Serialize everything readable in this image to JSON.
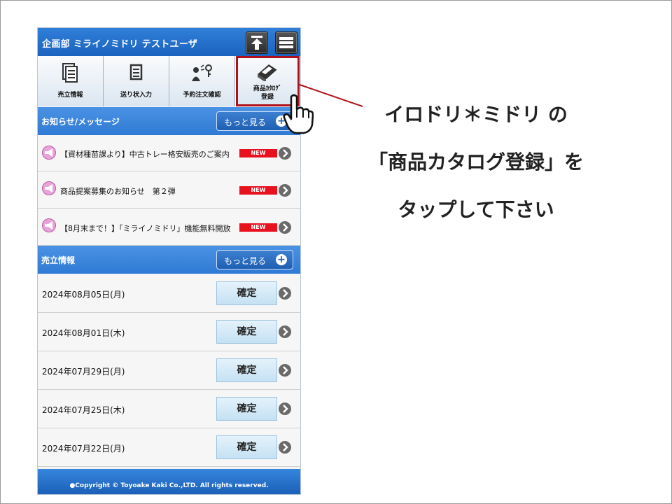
{
  "header": {
    "title": "企画部 ミライノミドリ テストユーザ"
  },
  "tabs": [
    {
      "label": "売立情報",
      "icon": "documents-icon"
    },
    {
      "label": "送り状入力",
      "icon": "document-icon"
    },
    {
      "label": "予約注文確認",
      "icon": "person-key-icon"
    },
    {
      "label": "商品ｶﾀﾛｸﾞ",
      "label2": "登録",
      "icon": "catalog-book-icon"
    }
  ],
  "notices": {
    "title": "お知らせ/メッセージ",
    "more_label": "もっと見る",
    "items": [
      {
        "text": "【資材種苗課より】中古トレー格安販売のご案内",
        "badge": "NEW"
      },
      {
        "text": "商品提案募集のお知らせ　第２弾",
        "badge": "NEW"
      },
      {
        "text": "【8月末まで！】「ミライノミドリ」機能無料開放",
        "badge": "NEW"
      }
    ]
  },
  "sales": {
    "title": "売立情報",
    "more_label": "もっと見る",
    "items": [
      {
        "date": "2024年08月05日(月)",
        "action": "確定"
      },
      {
        "date": "2024年08月01日(木)",
        "action": "確定"
      },
      {
        "date": "2024年07月29日(月)",
        "action": "確定"
      },
      {
        "date": "2024年07月25日(木)",
        "action": "確定"
      },
      {
        "date": "2024年07月22日(月)",
        "action": "確定"
      }
    ]
  },
  "footer": {
    "copyright": "●Copyright © Toyoake Kaki Co.,LTD. All rights reserved."
  },
  "callout": {
    "line1": "イロドリ＊ミドリ の",
    "line2": "「商品カタログ登録」を",
    "line3": "タップして下さい"
  },
  "colors": {
    "header_blue": "#1b63bf",
    "highlight_red": "#b0121b",
    "new_badge": "#e8121f"
  }
}
